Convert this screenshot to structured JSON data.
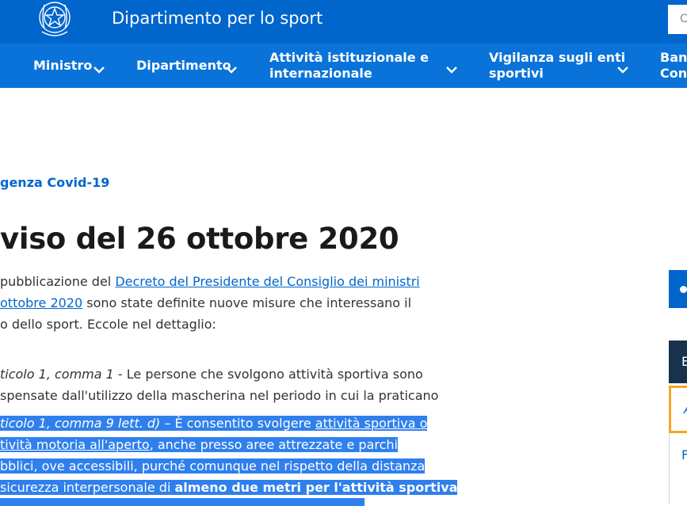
{
  "header": {
    "site_title": "Dipartimento per lo sport",
    "search_placeholder": "C"
  },
  "nav": {
    "items": [
      {
        "label_1": "Ministro",
        "label_2": ""
      },
      {
        "label_1": "Dipartimento",
        "label_2": ""
      },
      {
        "label_1": "Attività istituzionale e",
        "label_2": "internazionale"
      },
      {
        "label_1": "Vigilanza sugli enti",
        "label_2": "sportivi"
      },
      {
        "label_1": "Banc",
        "label_2": "Cont"
      }
    ]
  },
  "breadcrumb": "genza Covid-19",
  "page_title": "viso del 26 ottobre 2020",
  "article": {
    "p1_pre": "pubblicazione del ",
    "p1_link_a": "Decreto del Presidente del Consiglio dei ministri",
    "p1_link_b": "ottobre 2020",
    "p1_post": " sono state definite nuove misure che interessano il",
    "p1_line3": "o dello sport. Eccole nel dettaglio:",
    "p2_ref": "ticolo 1, comma 1",
    "p2_text": " - Le persone che svolgono attività sportiva sono",
    "p2_line2": "spensate dall'utilizzo della mascherina nel periodo in cui la praticano",
    "p3_ref": "ticolo 1, comma 9 lett. d)",
    "p3_dash": " – È consentito svolgere ",
    "p3_link_a": "attività sportiva o",
    "p3_link_b": "tività motoria all'aperto",
    "p3_line2_post": ", anche presso aree attrezzate e parchi",
    "p3_line3": "bblici, ove accessibili, purché comunque nel rispetto della distanza",
    "p3_line4_pre": "sicurezza interpersonale di ",
    "p3_line4_bold": "almeno due metri per l'attività sportiva"
  },
  "sidebar": {
    "box_b_text": "E",
    "box_c_text": "A",
    "link_d_text": "F"
  }
}
